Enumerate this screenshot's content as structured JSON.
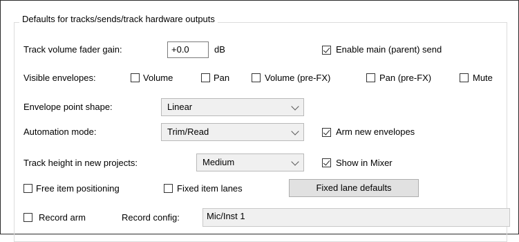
{
  "group": {
    "title": "Defaults for tracks/sends/track hardware outputs"
  },
  "fader_gain": {
    "label": "Track volume fader gain:",
    "value": "+0.0",
    "unit": "dB"
  },
  "main_send": {
    "label": "Enable main (parent) send",
    "checked": true
  },
  "visible_envelopes": {
    "label": "Visible envelopes:",
    "items": [
      {
        "label": "Volume",
        "checked": false
      },
      {
        "label": "Pan",
        "checked": false
      },
      {
        "label": "Volume (pre-FX)",
        "checked": false
      },
      {
        "label": "Pan (pre-FX)",
        "checked": false
      },
      {
        "label": "Mute",
        "checked": false
      }
    ]
  },
  "envelope_shape": {
    "label": "Envelope point shape:",
    "value": "Linear"
  },
  "automation_mode": {
    "label": "Automation mode:",
    "value": "Trim/Read"
  },
  "arm_envelopes": {
    "label": "Arm new envelopes",
    "checked": true
  },
  "track_height": {
    "label": "Track height in new projects:",
    "value": "Medium"
  },
  "show_mixer": {
    "label": "Show in Mixer",
    "checked": true
  },
  "free_positioning": {
    "label": "Free item positioning",
    "checked": false
  },
  "fixed_lanes": {
    "label": "Fixed item lanes",
    "checked": false
  },
  "fixed_lane_defaults": {
    "label": "Fixed lane defaults"
  },
  "record_arm": {
    "label": "Record arm",
    "checked": false
  },
  "record_config": {
    "label": "Record config:",
    "value": "Mic/Inst 1"
  }
}
